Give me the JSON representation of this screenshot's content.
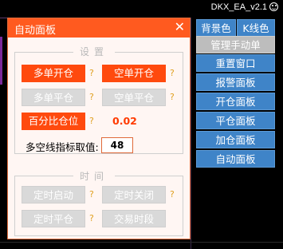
{
  "app": {
    "title": "DKX_EA_v2.1"
  },
  "panel": {
    "title": "自动面板",
    "close_glyph": "✕",
    "settings_group": "设置",
    "time_group": "时间",
    "buttons": {
      "single_open_long": "多单开仓",
      "single_open_short": "空单开仓",
      "close_long": "多单平仓",
      "close_short": "空单平仓",
      "pct_position": "百分比仓位",
      "timer_start": "定时启动",
      "timer_stop": "定时关闭",
      "timer_close": "定时平仓",
      "trade_period": "交易时段"
    },
    "help_mark": "?",
    "pct_value": "0.02",
    "indicator_label": "多空线指标取值:",
    "indicator_value": "48"
  },
  "menu": {
    "bg_color": "背景色",
    "k_color": "K线色",
    "items": [
      "管理手动单",
      "重置窗口",
      "报警面板",
      "开仓面板",
      "平仓面板",
      "加仓面板",
      "自动面板"
    ]
  },
  "colors": {
    "header": "#ff5a1f",
    "accent": "#ff4a0e",
    "menu_blue": "#3f84c8",
    "disabled": "#d9d9d9"
  }
}
